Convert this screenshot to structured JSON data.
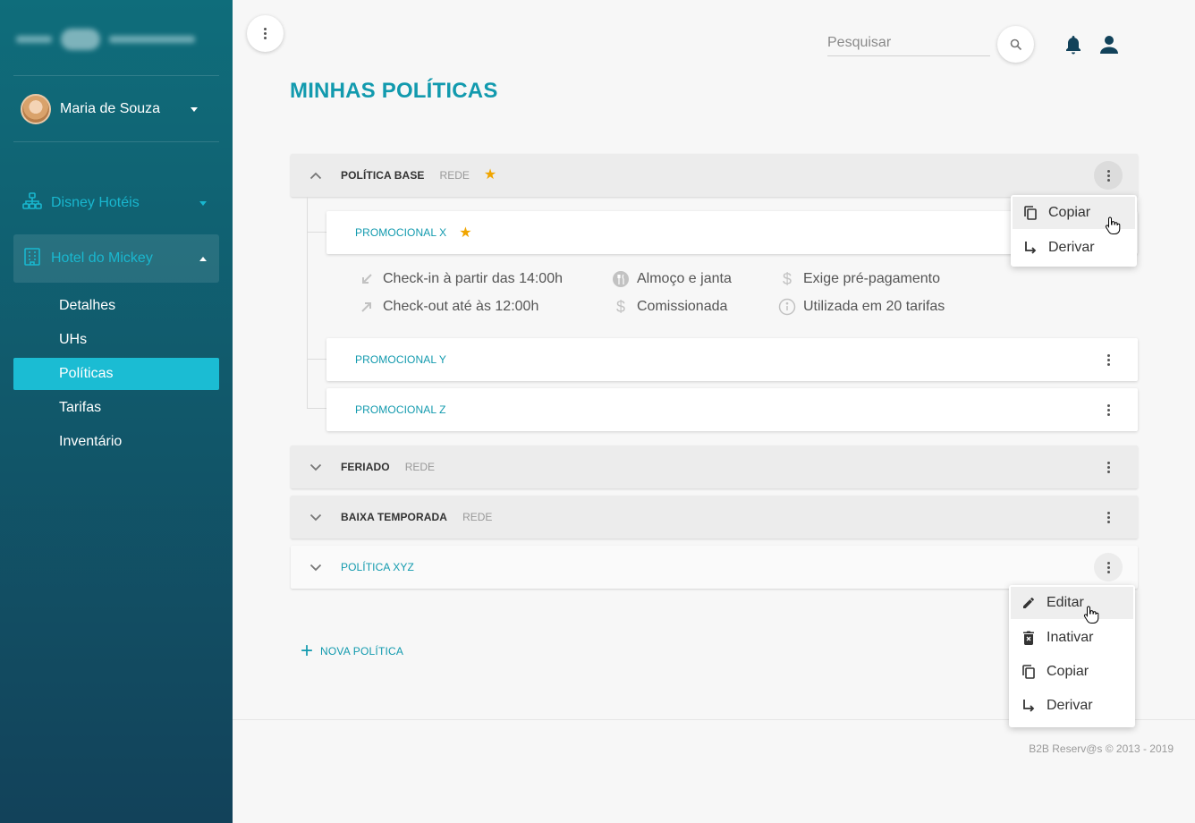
{
  "sidebar": {
    "user_name": "Maria de Souza",
    "groups": [
      {
        "label": "Disney Hotéis"
      },
      {
        "label": "Hotel do Mickey"
      }
    ],
    "items": [
      {
        "label": "Detalhes"
      },
      {
        "label": "UHs"
      },
      {
        "label": "Políticas"
      },
      {
        "label": "Tarifas"
      },
      {
        "label": "Inventário"
      }
    ],
    "active_item": "Políticas"
  },
  "header": {
    "search_placeholder": "Pesquisar"
  },
  "page": {
    "title": "MINHAS POLÍTICAS"
  },
  "policies": [
    {
      "name": "POLÍTICA BASE",
      "tag": "REDE",
      "starred": true,
      "expanded": true
    },
    {
      "name": "FERIADO",
      "tag": "REDE",
      "starred": false,
      "expanded": false
    },
    {
      "name": "BAIXA TEMPORADA",
      "tag": "REDE",
      "starred": false,
      "expanded": false
    },
    {
      "name": "POLÍTICA XYZ",
      "tag": "",
      "starred": false,
      "expanded": false
    }
  ],
  "children": [
    {
      "name": "PROMOCIONAL X",
      "starred": true
    },
    {
      "name": "PROMOCIONAL Y",
      "starred": false
    },
    {
      "name": "PROMOCIONAL Z",
      "starred": false
    }
  ],
  "details": {
    "checkin": "Check-in à partir das 14:00h",
    "checkout": "Check-out até às 12:00h",
    "meals": "Almoço e janta",
    "commission": "Comissionada",
    "prepayment": "Exige pré-pagamento",
    "usage": "Utilizada em 20 tarifas"
  },
  "new_policy_label": "NOVA POLÍTICA",
  "menu_child": {
    "items": [
      "Copiar",
      "Derivar"
    ]
  },
  "menu_policy": {
    "items": [
      "Editar",
      "Inativar",
      "Copiar",
      "Derivar"
    ]
  },
  "footer": "B2B Reserv@s © 2013 - 2019",
  "colors": {
    "accent": "#129aae",
    "sidebar_active": "#1bbcd3",
    "star": "#f0a500"
  }
}
